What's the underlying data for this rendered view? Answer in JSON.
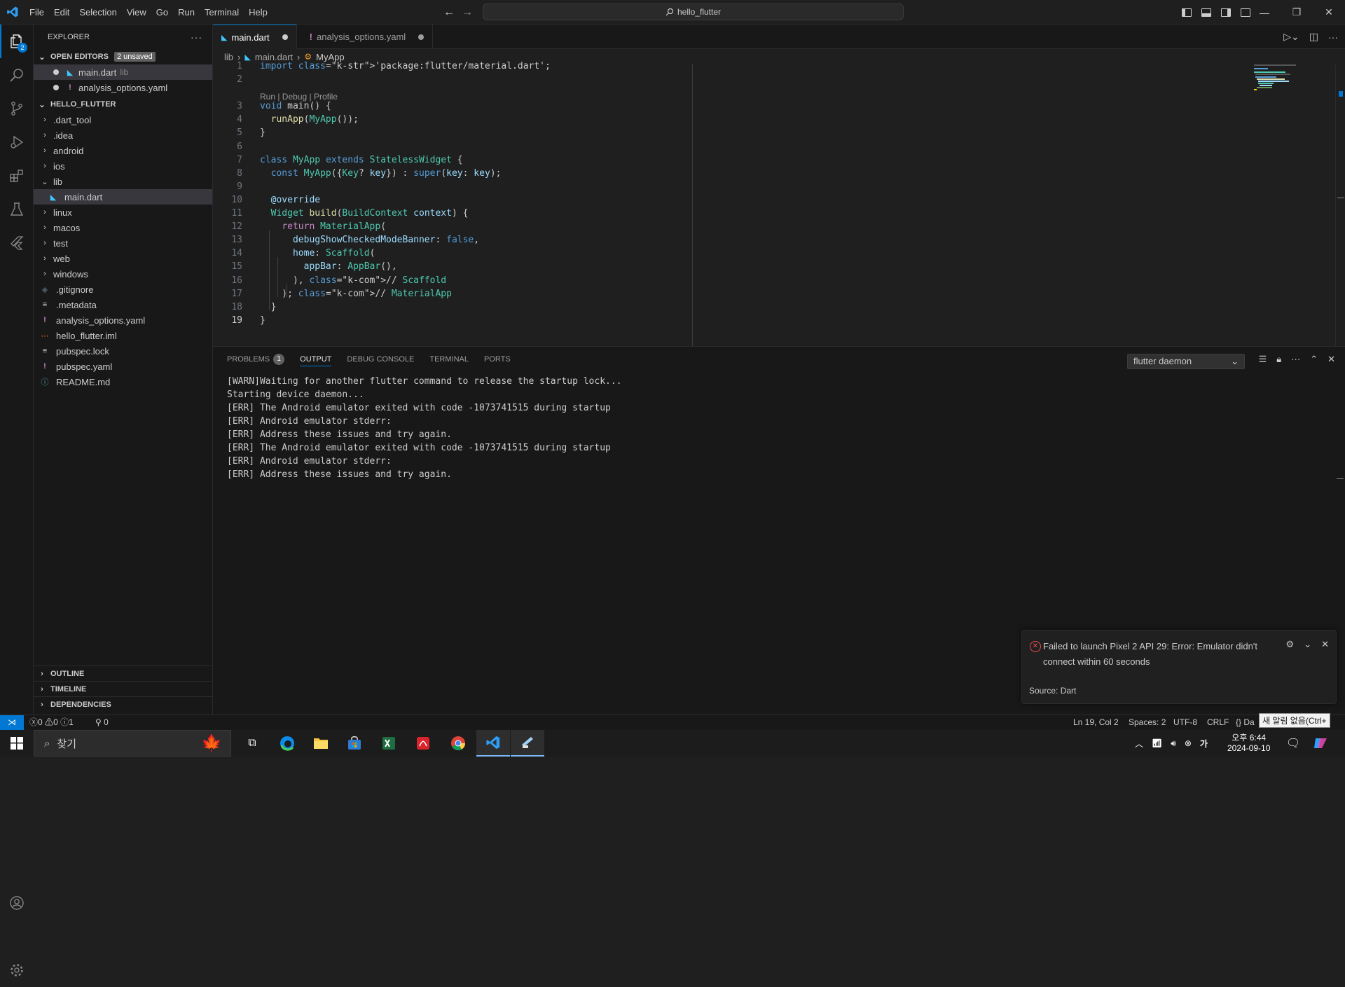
{
  "menu": [
    "File",
    "Edit",
    "Selection",
    "View",
    "Go",
    "Run",
    "Terminal",
    "Help"
  ],
  "command_center": "hello_flutter",
  "activity": {
    "explorer_badge": "2"
  },
  "sidebar": {
    "title": "EXPLORER",
    "open_editors": {
      "label": "OPEN EDITORS",
      "badge": "2 unsaved"
    },
    "open_files": [
      {
        "name": "main.dart",
        "hint": "lib"
      },
      {
        "name": "analysis_options.yaml",
        "hint": ""
      }
    ],
    "project": "HELLO_FLUTTER",
    "tree": [
      {
        "name": ".dart_tool",
        "type": "folder"
      },
      {
        "name": ".idea",
        "type": "folder"
      },
      {
        "name": "android",
        "type": "folder"
      },
      {
        "name": "ios",
        "type": "folder"
      },
      {
        "name": "lib",
        "type": "folder-open"
      },
      {
        "name": "main.dart",
        "type": "dart"
      },
      {
        "name": "linux",
        "type": "folder"
      },
      {
        "name": "macos",
        "type": "folder"
      },
      {
        "name": "test",
        "type": "folder"
      },
      {
        "name": "web",
        "type": "folder"
      },
      {
        "name": "windows",
        "type": "folder"
      },
      {
        "name": ".gitignore",
        "type": "git"
      },
      {
        "name": ".metadata",
        "type": "text"
      },
      {
        "name": "analysis_options.yaml",
        "type": "yaml"
      },
      {
        "name": "hello_flutter.iml",
        "type": "xml"
      },
      {
        "name": "pubspec.lock",
        "type": "text"
      },
      {
        "name": "pubspec.yaml",
        "type": "yaml"
      },
      {
        "name": "README.md",
        "type": "info"
      }
    ],
    "outline": "OUTLINE",
    "timeline": "TIMELINE",
    "dependencies": "DEPENDENCIES"
  },
  "tabs": [
    {
      "label": "main.dart",
      "active": true
    },
    {
      "label": "analysis_options.yaml",
      "active": false
    }
  ],
  "breadcrumb": [
    "lib",
    "main.dart",
    "MyApp"
  ],
  "codelens": "Run | Debug | Profile",
  "current_line": 19,
  "code_lines": [
    {
      "n": 1,
      "t": "import 'package:flutter/material.dart';"
    },
    {
      "n": 2,
      "t": ""
    },
    {
      "n": 3,
      "t": "void main() {"
    },
    {
      "n": 4,
      "t": "  runApp(MyApp());"
    },
    {
      "n": 5,
      "t": "}"
    },
    {
      "n": 6,
      "t": ""
    },
    {
      "n": 7,
      "t": "class MyApp extends StatelessWidget {"
    },
    {
      "n": 8,
      "t": "  const MyApp({Key? key}) : super(key: key);"
    },
    {
      "n": 9,
      "t": ""
    },
    {
      "n": 10,
      "t": "  @override"
    },
    {
      "n": 11,
      "t": "  Widget build(BuildContext context) {"
    },
    {
      "n": 12,
      "t": "    return MaterialApp("
    },
    {
      "n": 13,
      "t": "      debugShowCheckedModeBanner: false,"
    },
    {
      "n": 14,
      "t": "      home: Scaffold("
    },
    {
      "n": 15,
      "t": "        appBar: AppBar(),"
    },
    {
      "n": 16,
      "t": "      ), // Scaffold"
    },
    {
      "n": 17,
      "t": "    ); // MaterialApp"
    },
    {
      "n": 18,
      "t": "  }"
    },
    {
      "n": 19,
      "t": "}"
    }
  ],
  "panel": {
    "tabs": [
      {
        "label": "PROBLEMS",
        "badge": "1"
      },
      {
        "label": "OUTPUT",
        "badge": ""
      },
      {
        "label": "DEBUG CONSOLE",
        "badge": ""
      },
      {
        "label": "TERMINAL",
        "badge": ""
      },
      {
        "label": "PORTS",
        "badge": ""
      }
    ],
    "active_tab": "OUTPUT",
    "channel": "flutter daemon",
    "output": [
      "[WARN]Waiting for another flutter command to release the startup lock...",
      "Starting device daemon...",
      "[ERR] The Android emulator exited with code -1073741515 during startup",
      "[ERR] Android emulator stderr:",
      "[ERR] Address these issues and try again.",
      "[ERR] The Android emulator exited with code -1073741515 during startup",
      "[ERR] Android emulator stderr:",
      "[ERR] Address these issues and try again."
    ]
  },
  "notification": {
    "message": "Failed to launch Pixel 2 API 29: Error: Emulator didn't connect within 60 seconds",
    "source": "Source: Dart"
  },
  "status": {
    "errors": "0",
    "warnings": "0",
    "infos": "1",
    "ports": "0",
    "position": "Ln 19, Col 2",
    "spaces": "Spaces: 2",
    "encoding": "UTF-8",
    "eol": "CRLF",
    "language": "{} Da",
    "ime_tip": "새 알림 없음(Ctrl+"
  },
  "taskbar": {
    "search_placeholder": "찾기",
    "time": "오후 6:44",
    "date": "2024-09-10"
  },
  "colors": {
    "accent": "#0078d4",
    "error": "#f14c4c",
    "badge": "#616161"
  }
}
